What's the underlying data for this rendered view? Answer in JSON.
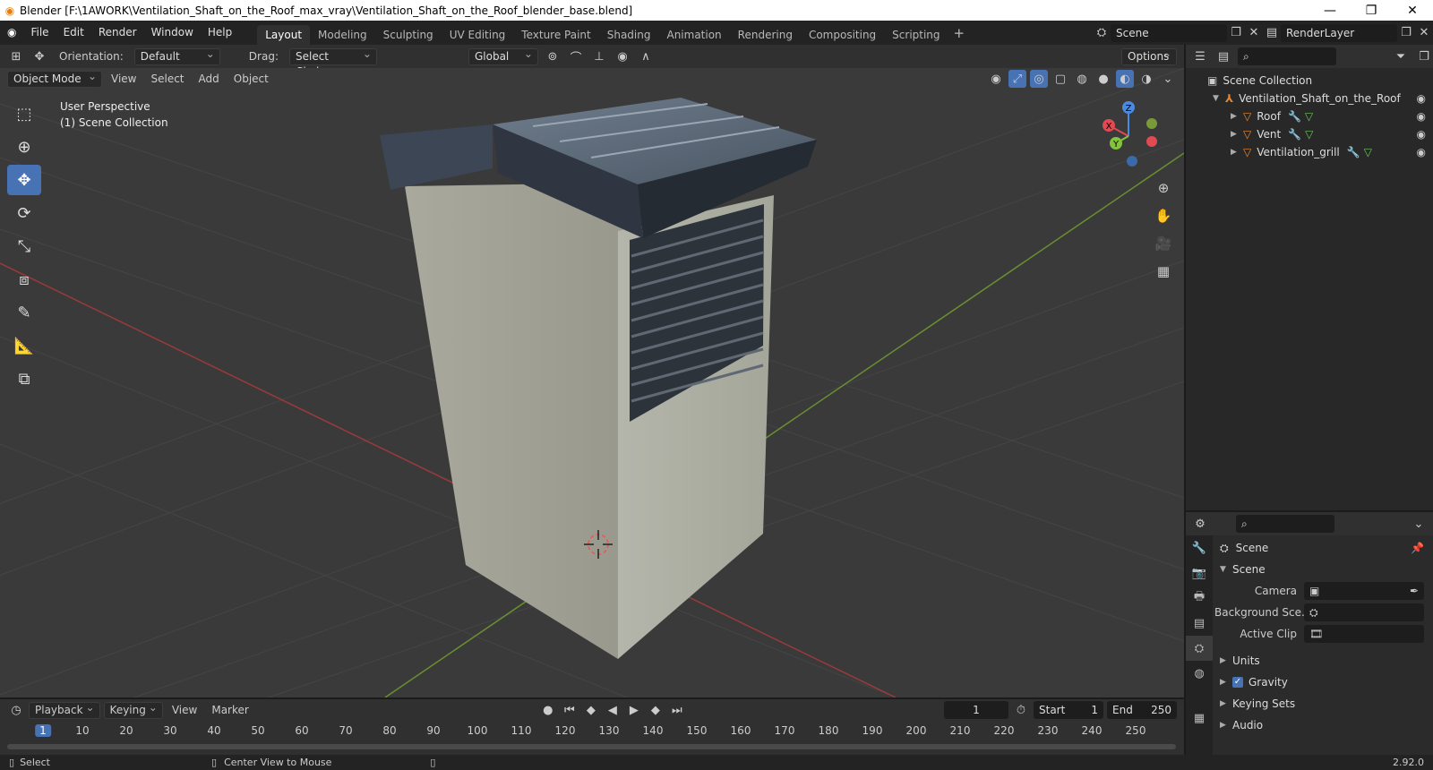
{
  "window": {
    "title": "Blender [F:\\1AWORK\\Ventilation_Shaft_on_the_Roof_max_vray\\Ventilation_Shaft_on_the_Roof_blender_base.blend]",
    "minimize": "—",
    "restore": "❐",
    "close": "✕"
  },
  "menu": {
    "file": "File",
    "edit": "Edit",
    "render": "Render",
    "window": "Window",
    "help": "Help"
  },
  "workspaces": [
    "Layout",
    "Modeling",
    "Sculpting",
    "UV Editing",
    "Texture Paint",
    "Shading",
    "Animation",
    "Rendering",
    "Compositing",
    "Scripting"
  ],
  "top_right": {
    "scene": "Scene",
    "render_layer": "RenderLayer"
  },
  "tool_header": {
    "orientation_label": "Orientation:",
    "orientation_value": "Default",
    "drag_label": "Drag:",
    "drag_value": "Select Circle",
    "transform_orientation": "Global",
    "options": "Options"
  },
  "viewport_header": {
    "mode": "Object Mode",
    "view": "View",
    "select": "Select",
    "add": "Add",
    "object": "Object"
  },
  "viewport_overlay": {
    "perspective": "User Perspective",
    "collection": "(1) Scene Collection"
  },
  "gizmo": {
    "x": "X",
    "y": "Y",
    "z": "Z",
    "colors": {
      "x": "#e04a52",
      "y": "#84c43c",
      "z": "#4a8be0"
    }
  },
  "outliner": {
    "root": "Scene Collection",
    "collection": "Ventilation_Shaft_on_the_Roof",
    "objects": [
      "Roof",
      "Vent",
      "Ventilation_grill"
    ]
  },
  "properties": {
    "context": "Scene",
    "panel_scene": "Scene",
    "camera_label": "Camera",
    "background_label": "Background Sce...",
    "active_clip_label": "Active Clip",
    "units": "Units",
    "gravity": "Gravity",
    "keying_sets": "Keying Sets",
    "audio": "Audio"
  },
  "timeline": {
    "playback": "Playback",
    "keying": "Keying",
    "view": "View",
    "marker": "Marker",
    "current_frame": "1",
    "start_label": "Start",
    "start_value": "1",
    "end_label": "End",
    "end_value": "250",
    "ruler": [
      "1",
      "10",
      "20",
      "30",
      "40",
      "50",
      "60",
      "70",
      "80",
      "90",
      "100",
      "110",
      "120",
      "130",
      "140",
      "150",
      "160",
      "170",
      "180",
      "190",
      "200",
      "210",
      "220",
      "230",
      "240",
      "250"
    ]
  },
  "status": {
    "select": "Select",
    "center_view": "Center View to Mouse",
    "version": "2.92.0"
  },
  "colors": {
    "accent": "#4772b3",
    "brand": "#e87d0d"
  }
}
